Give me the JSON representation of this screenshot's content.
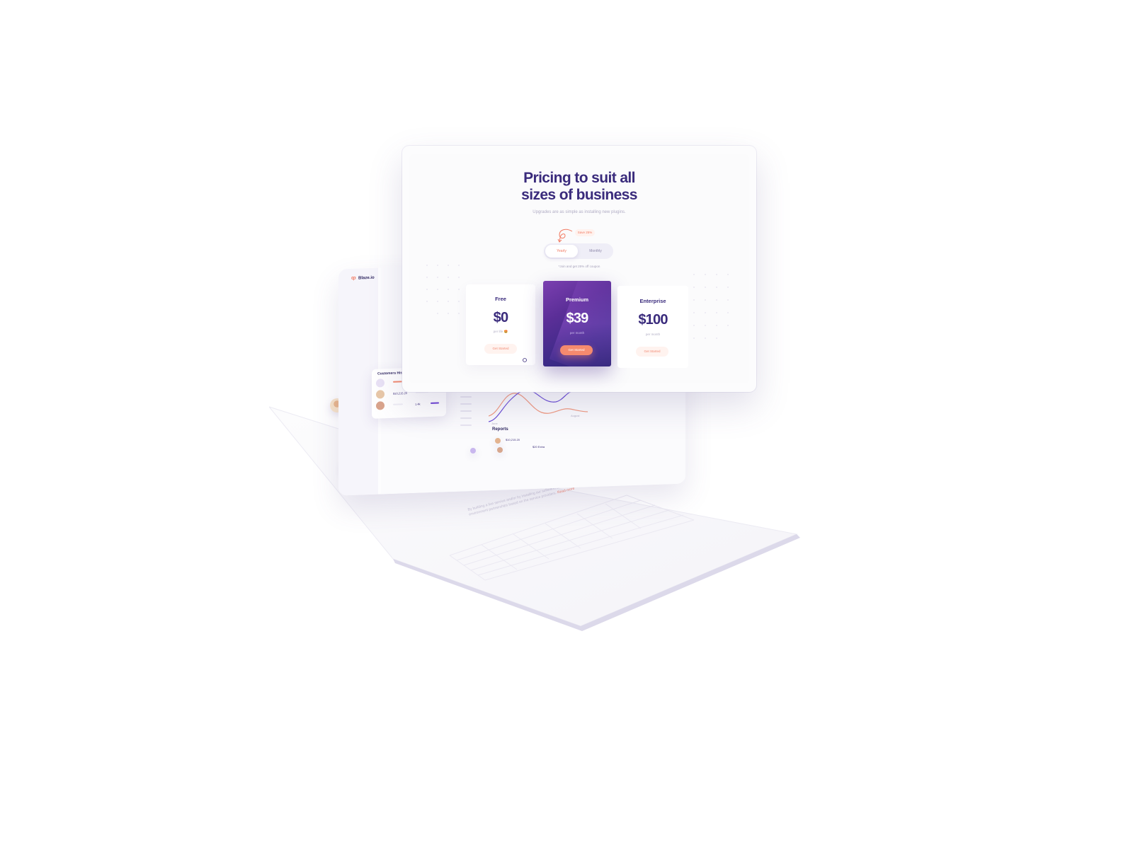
{
  "colors": {
    "brand_purple": "#3a2b7c",
    "accent_coral": "#f58a6e",
    "premium_gradient_start": "#7b3fb0",
    "premium_gradient_end": "#2f2577"
  },
  "pricing": {
    "headline_line1": "Pricing to suit all",
    "headline_line2": "sizes of business",
    "subheadline": "Upgrades are as simple as installing new plugins.",
    "save_badge": "Save 25%",
    "toggle": {
      "yearly": "Yearly",
      "monthly": "Monthly",
      "selected": "Yearly"
    },
    "coupon_note": "*Join and get 25% off coupon",
    "plans": [
      {
        "name": "Free",
        "price": "$0",
        "period": "per life",
        "emoji": "🤩",
        "button": "Get Started"
      },
      {
        "name": "Premium",
        "price": "$39",
        "period": "per month",
        "button": "Get Started"
      },
      {
        "name": "Enterprise",
        "price": "$100",
        "period": "per month",
        "button": "Get Started"
      }
    ]
  },
  "dashboard": {
    "brand": "Blaze.io",
    "customers_history": {
      "title": "Customers History",
      "rows": [
        {
          "amount": ""
        },
        {
          "amount": "$10,215.20"
        },
        {
          "amount": "1.4k"
        }
      ]
    },
    "chart_labels": {
      "start": "June",
      "end": "August"
    },
    "reports": {
      "title": "Reports",
      "rows": [
        {
          "amount": "$10,215.20"
        },
        {
          "amount": "$20 Extra"
        }
      ]
    }
  },
  "laptop": {
    "deck_text": "By building a live service and/or by installing our software, an extension of a physical environment partnerships based on the service providers.",
    "deck_link": "Read more"
  }
}
